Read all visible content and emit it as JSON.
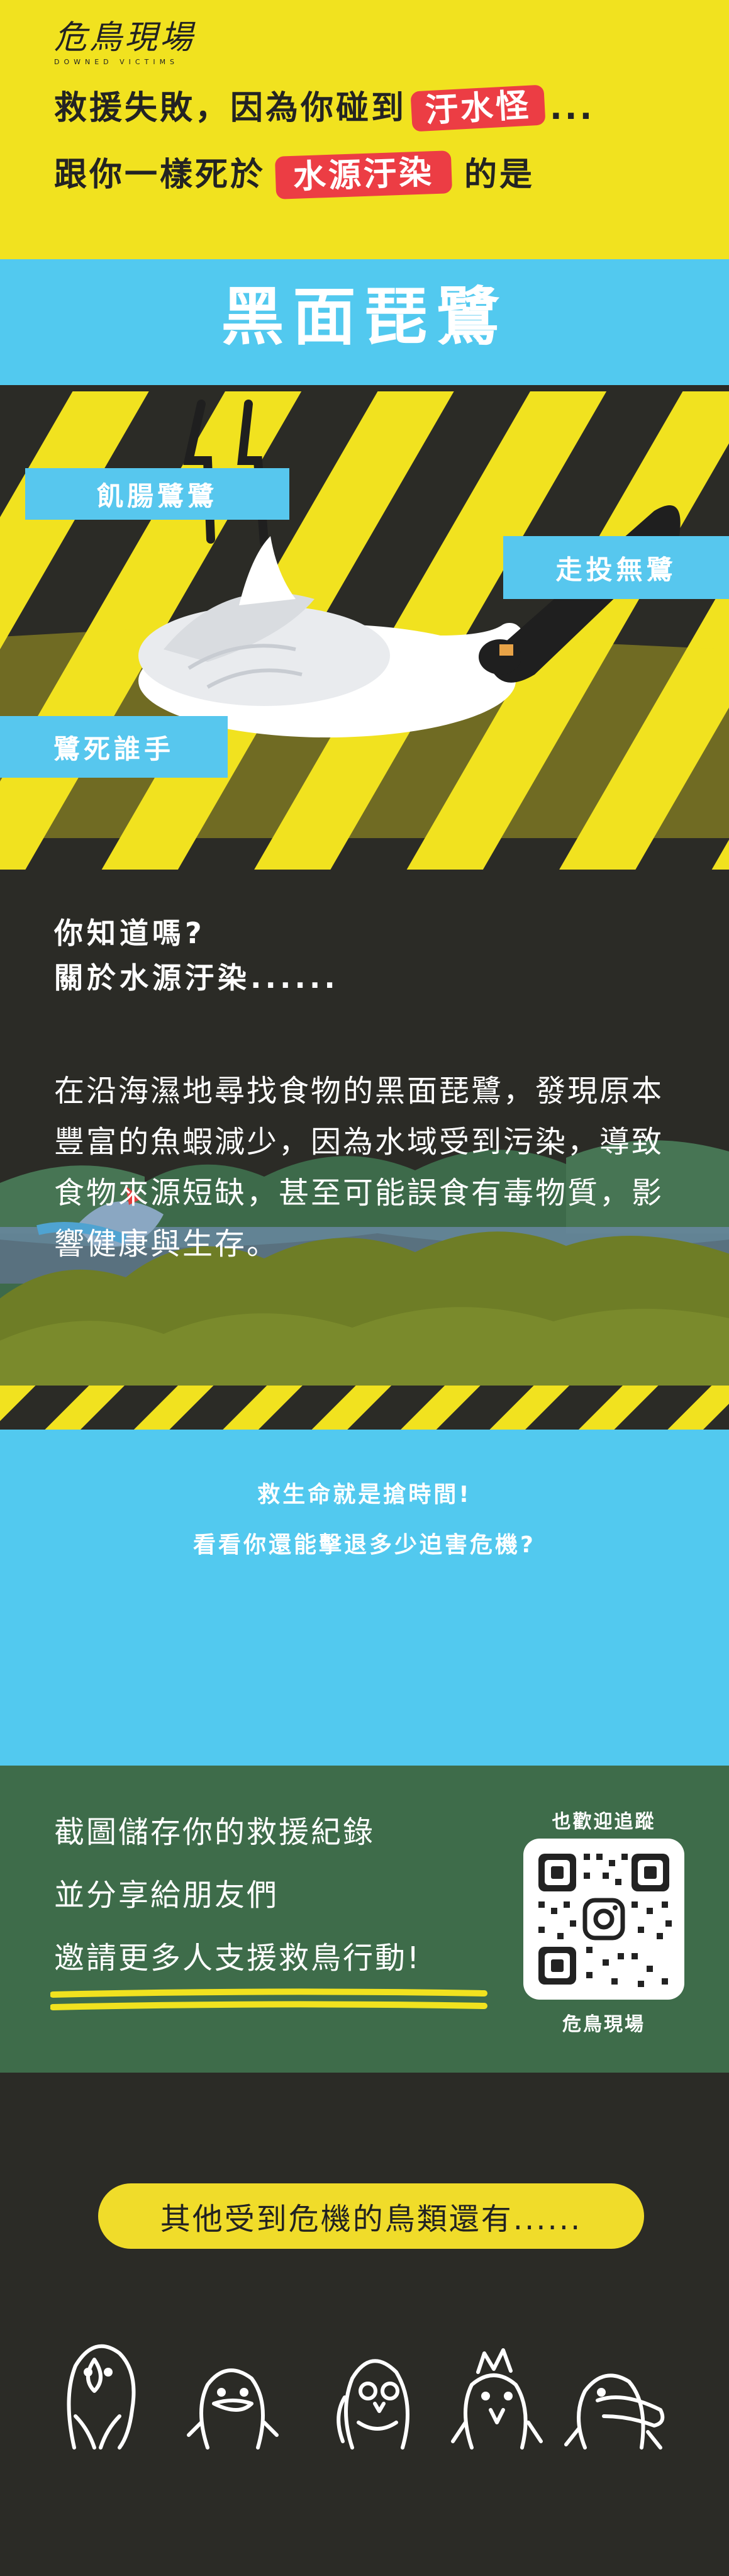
{
  "logo": {
    "title": "危鳥現場",
    "subtitle": "DOWNED VICTIMS"
  },
  "headline": {
    "line1_a": "救援失敗，因為你碰到",
    "line1_chip": "汙水怪",
    "line1_b": "...",
    "line2_a": "跟你一樣死於",
    "line2_chip": "水源汙染",
    "line2_b": "的是"
  },
  "bird_name": "黑面琵鷺",
  "tags": [
    "飢腸鷺鷺",
    "走投無鷺",
    "鷺死誰手"
  ],
  "info": {
    "q1": "你知道嗎?",
    "q2": "關於水源汙染......",
    "text": "在沿海濕地尋找食物的黑面琵鷺，發現原本豐富的魚蝦減少，因為水域受到污染，導致食物來源短缺，甚至可能誤食有毒物質，影響健康與生存。"
  },
  "cta": {
    "line1": "救生命就是搶時間!",
    "line2": "看看你還能擊退多少迫害危機?"
  },
  "share": {
    "lines": [
      "截圖儲存你的救援紀錄",
      "並分享給朋友們",
      "邀請更多人支援救鳥行動!"
    ],
    "follow": "也歡迎追蹤",
    "account": "危鳥現場",
    "icon": "instagram-icon"
  },
  "more_birds": "其他受到危機的鳥類還有......",
  "colors": {
    "yellow": "#f1e21f",
    "blue": "#52c9ef",
    "red": "#ec3d44",
    "dark": "#2b2b26",
    "green": "#3e6c4a"
  }
}
